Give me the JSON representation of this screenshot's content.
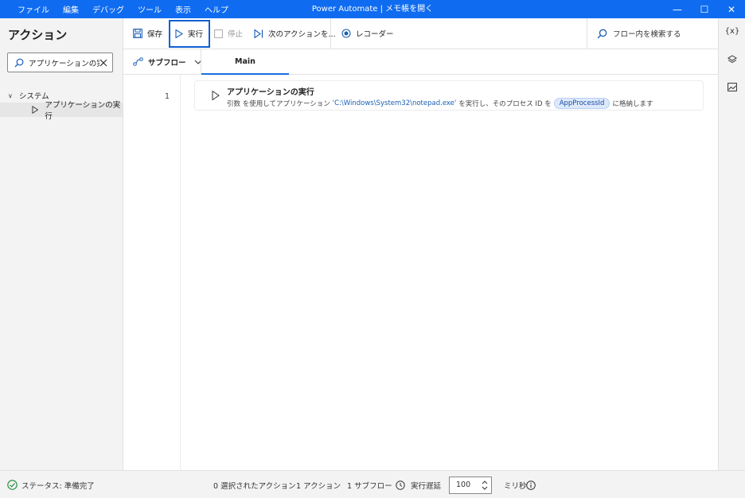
{
  "titlebar": {
    "menu": [
      "ファイル",
      "編集",
      "デバッグ",
      "ツール",
      "表示",
      "ヘルプ"
    ],
    "title": "Power Automate | メモ帳を開く",
    "controls": {
      "minimize": "—",
      "maximize": "☐",
      "close": "✕"
    }
  },
  "actions_panel": {
    "title": "アクション",
    "search_value": "アプリケーションの実",
    "group": {
      "chevron": "∨",
      "label": "システム"
    },
    "item": {
      "label": "アプリケーションの実行"
    }
  },
  "toolbar": {
    "save": "保存",
    "run": "実行",
    "stop": "停止",
    "next_action": "次のアクションを...",
    "recorder": "レコーダー",
    "search_placeholder": "フロー内を検索する"
  },
  "tabs": {
    "subflow": "サブフロー",
    "main": "Main"
  },
  "flow": {
    "line_number": "1",
    "action": {
      "title": "アプリケーションの実行",
      "desc_prefix": "引数  を使用してアプリケーション",
      "path": "'C:\\Windows\\System32\\notepad.exe'",
      "desc_mid": "を実行し、そのプロセス ID を",
      "variable": "AppProcessId",
      "desc_suffix": "に格納します"
    }
  },
  "right_rail": {
    "variables_icon": "{x}"
  },
  "statusbar": {
    "status": "ステータス: 準備完了",
    "selected_actions": "0 選択されたアクション",
    "actions_count": "1 アクション",
    "subflows_count": "1 サブフロー",
    "delay_label": "実行遅延",
    "delay_value": "100",
    "delay_unit": "ミリ秒"
  },
  "colors": {
    "titlebar": "#0f6cf1",
    "accent": "#1a5fb4",
    "variable_pill": "#dde9fb",
    "status_ok": "#1e8a3a"
  },
  "icons": [
    "search-icon",
    "close-icon",
    "play-icon",
    "save-icon",
    "stop-icon",
    "next-action-icon",
    "recorder-icon",
    "subflow-icon",
    "chevron-down-icon",
    "variables-icon",
    "layers-icon",
    "images-icon",
    "check-circle-icon",
    "clock-icon",
    "info-icon"
  ]
}
